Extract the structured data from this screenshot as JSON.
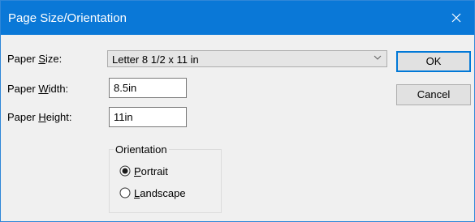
{
  "window": {
    "title": "Page Size/Orientation",
    "close_icon": "close-icon"
  },
  "form": {
    "paper_size": {
      "label_pre": "Paper ",
      "label_mnemonic": "S",
      "label_post": "ize:",
      "value": "Letter 8 1/2 x 11 in"
    },
    "paper_width": {
      "label_pre": "Paper ",
      "label_mnemonic": "W",
      "label_post": "idth:",
      "value": "8.5in"
    },
    "paper_height": {
      "label_pre": "Paper ",
      "label_mnemonic": "H",
      "label_post": "eight:",
      "value": "11in"
    }
  },
  "orientation": {
    "group_label": "Orientation",
    "portrait": {
      "mnemonic": "P",
      "rest": "ortrait",
      "checked": true
    },
    "landscape": {
      "mnemonic": "L",
      "rest": "andscape",
      "checked": false
    }
  },
  "buttons": {
    "ok": "OK",
    "cancel": "Cancel"
  },
  "colors": {
    "titlebar": "#0a78d7",
    "focus_border": "#0078d7",
    "dialog_bg": "#f0f0f0"
  }
}
